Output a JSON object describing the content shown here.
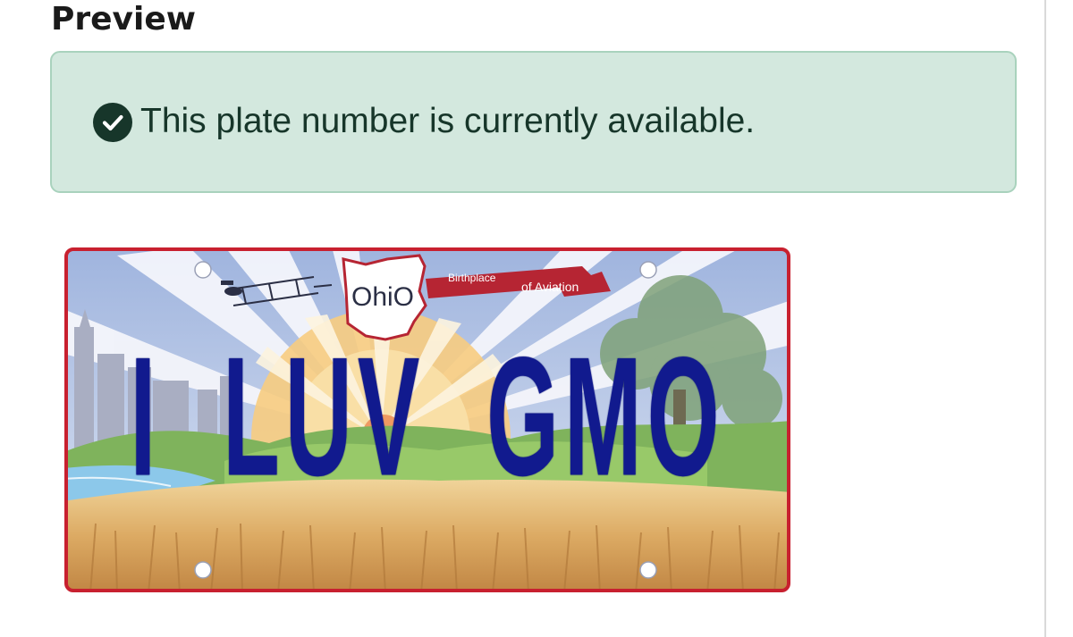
{
  "preview": {
    "heading": "Preview"
  },
  "availability": {
    "message": "This plate number is currently available.",
    "status_icon": "check-circle-icon",
    "status_color": "#17362a",
    "background_color": "#d3e8de"
  },
  "plate": {
    "number": "I LUV GMO",
    "state": "OhiO",
    "banner_left": "Birthplace",
    "banner_right": "of Aviation",
    "text_color": "#111a8e",
    "border_color": "#c8202f"
  }
}
